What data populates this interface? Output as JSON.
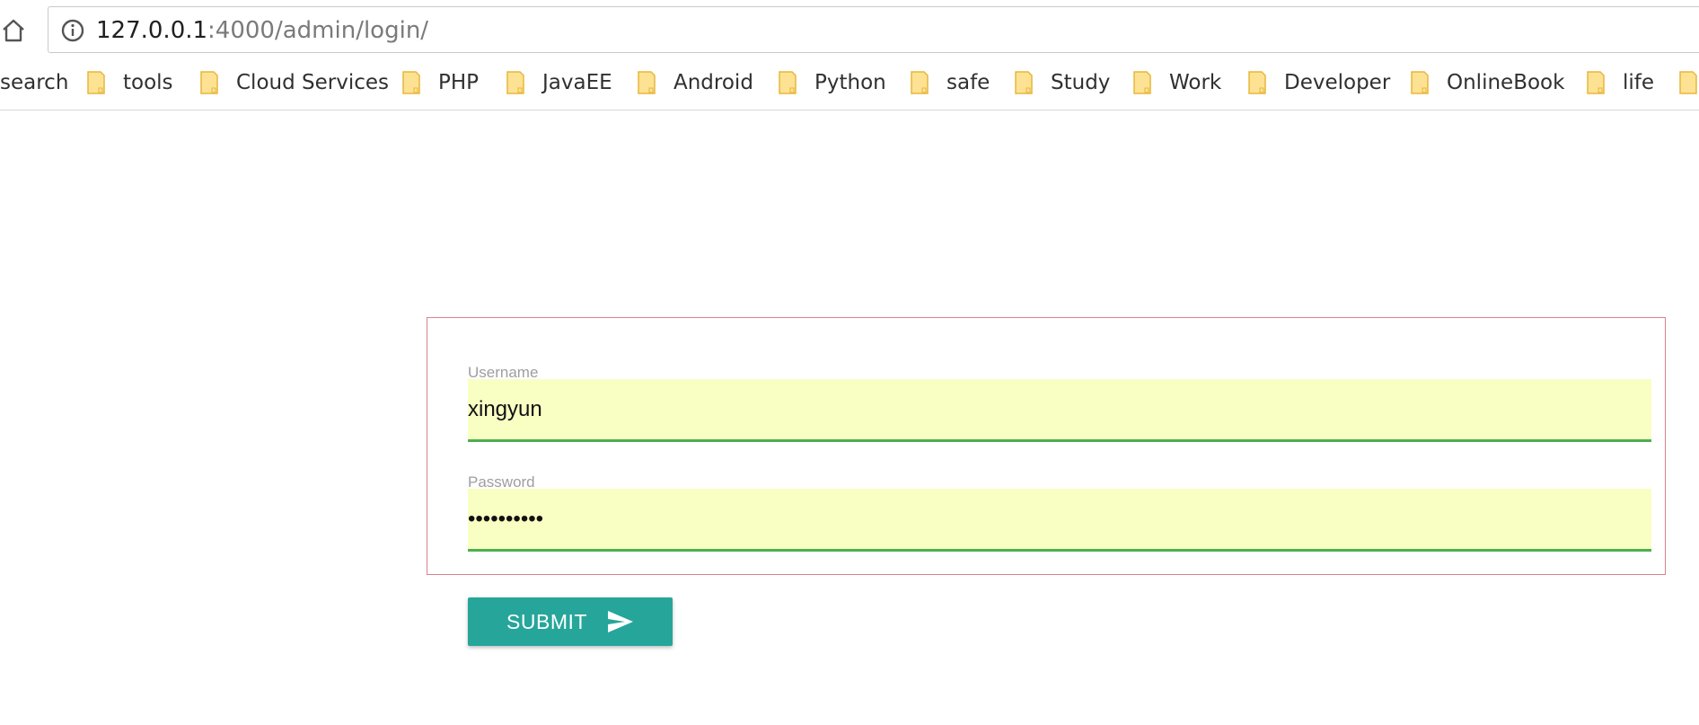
{
  "browser": {
    "url_host": "127.0.0.1",
    "url_rest": ":4000/admin/login/",
    "home_icon": "home-icon",
    "info_icon": "info-icon"
  },
  "bookmarks": [
    {
      "label": "search",
      "has_folder": false
    },
    {
      "label": "tools",
      "has_folder": true
    },
    {
      "label": "Cloud Services",
      "has_folder": true
    },
    {
      "label": "PHP",
      "has_folder": true
    },
    {
      "label": "JavaEE",
      "has_folder": true
    },
    {
      "label": "Android",
      "has_folder": true
    },
    {
      "label": "Python",
      "has_folder": true
    },
    {
      "label": "safe",
      "has_folder": true
    },
    {
      "label": "Study",
      "has_folder": true
    },
    {
      "label": "Work",
      "has_folder": true
    },
    {
      "label": "Developer",
      "has_folder": true
    },
    {
      "label": "OnlineBook",
      "has_folder": true
    },
    {
      "label": "life",
      "has_folder": true
    },
    {
      "label": "",
      "has_folder": true
    }
  ],
  "form": {
    "username_label": "Username",
    "username_value": "xingyun",
    "password_label": "Password",
    "password_value": "••••••••••",
    "submit_label": "SUBMIT",
    "submit_icon": "send-icon"
  },
  "colors": {
    "autofill_bg": "#f9fec3",
    "valid_underline": "#4caf50",
    "box_border": "#d9828a",
    "button_bg": "#26a69a",
    "folder_fill": "#fde293",
    "folder_stroke": "#e7b73b"
  }
}
